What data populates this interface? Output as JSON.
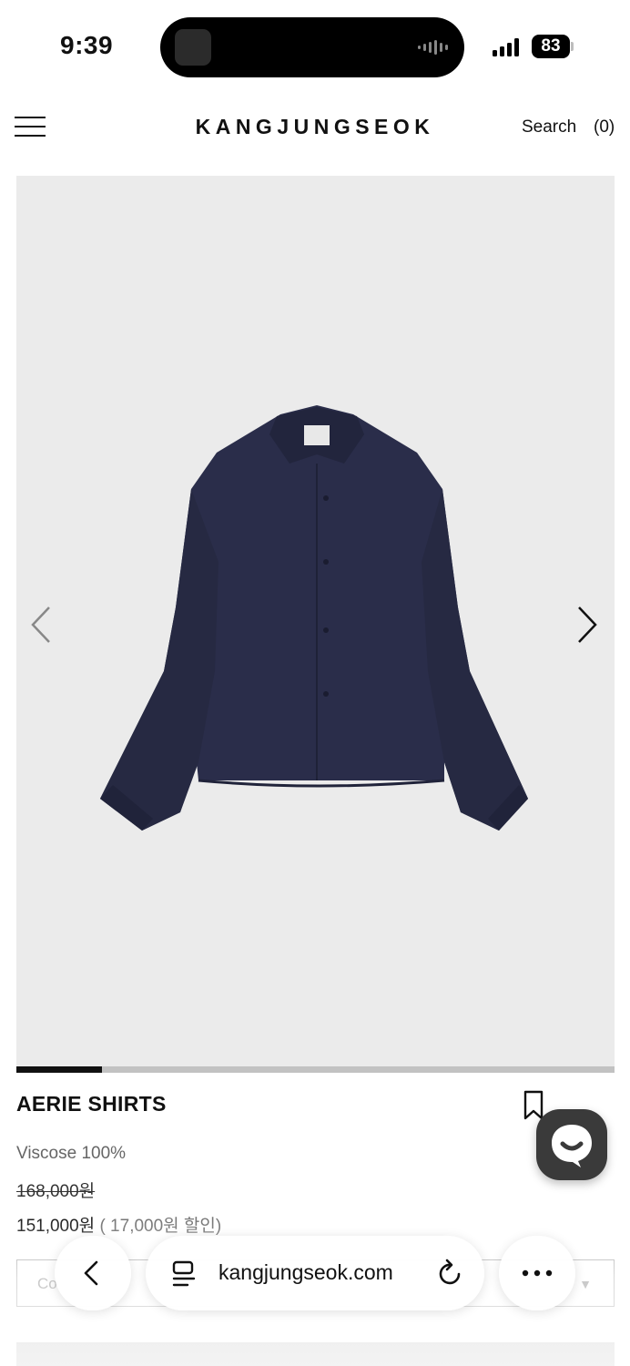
{
  "status_bar": {
    "time": "9:39",
    "battery": "83",
    "icons": [
      "signal-icon",
      "battery-icon",
      "island-audio-wave-icon"
    ]
  },
  "header": {
    "brand": "KANGJUNGSEOK",
    "search_label": "Search",
    "cart_label": "(0)",
    "icons": [
      "menu-icon"
    ]
  },
  "gallery": {
    "image": "navy long-sleeve shirt",
    "icons": [
      "chevron-left-icon",
      "chevron-right-icon"
    ],
    "progress_fraction": 0.143
  },
  "product": {
    "title": "AERIE SHIRTS",
    "material": "Viscose 100%",
    "original_price": "168,000원",
    "sale_price": "151,000원",
    "discount_note": "( 17,000원 할인)",
    "icons": [
      "bookmark-icon",
      "chat-icon"
    ]
  },
  "option_select": {
    "visible_text": "Co",
    "icon": "dropdown-arrow-icon"
  },
  "browser": {
    "url": "kangjungseok.com",
    "icons": [
      "back-icon",
      "reader-icon",
      "reload-icon",
      "more-icon"
    ]
  },
  "colors": {
    "gallery_background": "#ebebeb",
    "shirt": "#2a2d4a",
    "progress_fill": "#111111",
    "progress_track": "#c2c2c2",
    "chat_button": "#3a3a3a"
  }
}
